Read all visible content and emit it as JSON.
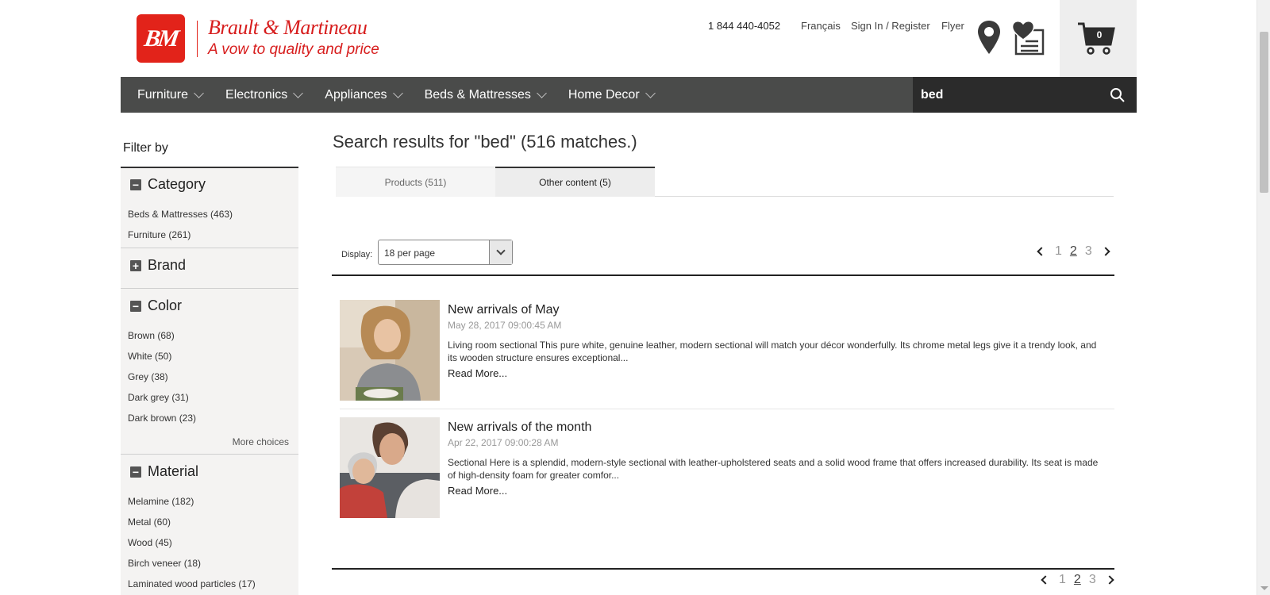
{
  "brand": {
    "logo_text": "BM",
    "name": "Brault & Martineau",
    "tagline": "A vow to quality and price",
    "color": "#e2231a"
  },
  "top_links": {
    "phone": "1 844 440-4052",
    "language": "Français",
    "signin": "Sign In / Register",
    "flyer": "Flyer"
  },
  "icons": {
    "store_locator": "map-pin-icon",
    "wishlist": "heart-list-icon",
    "cart": "cart-icon",
    "search": "search-icon"
  },
  "cart": {
    "count": "0"
  },
  "nav": {
    "items": [
      {
        "label": "Furniture"
      },
      {
        "label": "Electronics"
      },
      {
        "label": "Appliances"
      },
      {
        "label": "Beds & Mattresses"
      },
      {
        "label": "Home Decor"
      }
    ]
  },
  "search": {
    "value": "bed"
  },
  "sidebar": {
    "title": "Filter by",
    "facets": [
      {
        "name": "Category",
        "state": "expanded",
        "toggle": "−",
        "options": [
          "Beds & Mattresses (463)",
          "Furniture (261)"
        ]
      },
      {
        "name": "Brand",
        "state": "collapsed",
        "toggle": "+",
        "options": []
      },
      {
        "name": "Color",
        "state": "expanded",
        "toggle": "−",
        "options": [
          "Brown (68)",
          "White (50)",
          "Grey (38)",
          "Dark grey (31)",
          "Dark brown (23)"
        ],
        "more": "More choices"
      },
      {
        "name": "Material",
        "state": "expanded",
        "toggle": "−",
        "options": [
          "Melamine (182)",
          "Metal (60)",
          "Wood (45)",
          "Birch veneer (18)",
          "Laminated wood particles (17)"
        ]
      }
    ]
  },
  "main": {
    "title": "Search results for \"bed\" (516 matches.)",
    "tabs": [
      {
        "label": "Products (511)",
        "active": false
      },
      {
        "label": "Other content (5)",
        "active": true
      }
    ],
    "display_label": "Display:",
    "per_page": "18 per page",
    "pages": [
      "1",
      "2",
      "3"
    ],
    "current_page": "2",
    "results": [
      {
        "title": "New arrivals of May",
        "date": "May 28, 2017 09:00:45 AM",
        "description": "Living room sectional This pure white, genuine leather, modern sectional will match your décor wonderfully. Its chrome metal legs give it a trendy look, and its wooden structure ensures exceptional...",
        "more": "Read More...",
        "image": "woman-smiling-photo"
      },
      {
        "title": "New arrivals of the month",
        "date": "Apr 22, 2017 09:00:28 AM",
        "description": "Sectional Here is a splendid, modern-style sectional with leather-upholstered seats and a solid wood frame that offers increased durability. Its seat is made of high-density foam for greater comfor...",
        "more": "Read More...",
        "image": "couple-smiling-photo"
      }
    ]
  }
}
